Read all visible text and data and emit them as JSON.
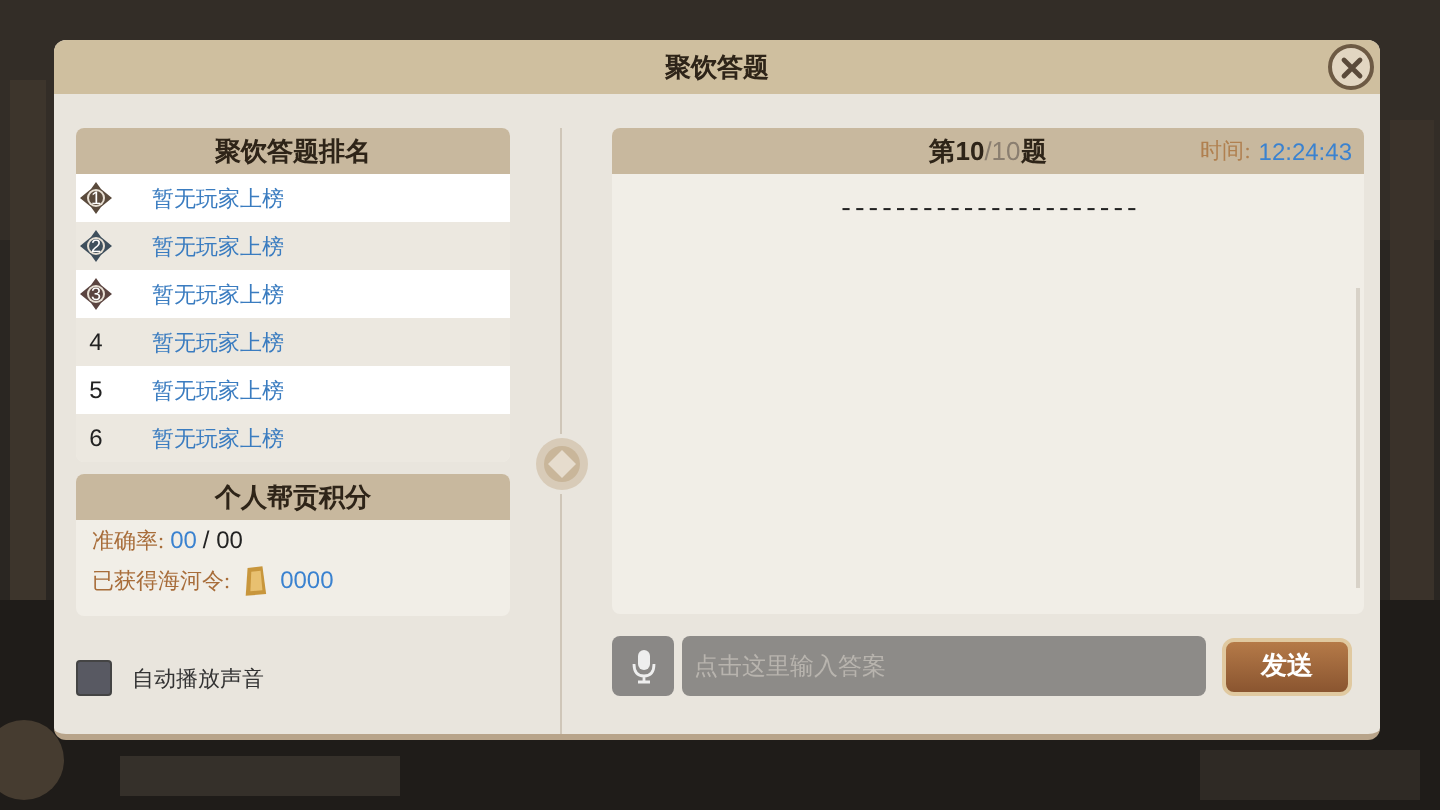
{
  "window": {
    "title": "聚饮答题"
  },
  "ranking": {
    "title": "聚饮答题排名",
    "rows": [
      {
        "rank": "1",
        "name": "暂无玩家上榜",
        "kind": "medal",
        "color": "#5a4a3c"
      },
      {
        "rank": "2",
        "name": "暂无玩家上榜",
        "kind": "medal",
        "color": "#3f4f5c"
      },
      {
        "rank": "3",
        "name": "暂无玩家上榜",
        "kind": "medal",
        "color": "#5b4440"
      },
      {
        "rank": "4",
        "name": "暂无玩家上榜",
        "kind": "plain"
      },
      {
        "rank": "5",
        "name": "暂无玩家上榜",
        "kind": "plain"
      },
      {
        "rank": "6",
        "name": "暂无玩家上榜",
        "kind": "plain"
      }
    ]
  },
  "score": {
    "title": "个人帮贡积分",
    "accuracy_label": "准确率:",
    "accuracy_correct": "00",
    "accuracy_total": "/ 00",
    "token_label": "已获得海河令:",
    "token_value": "0000"
  },
  "auto_play": {
    "label": "自动播放声音",
    "checked": false
  },
  "question": {
    "prefix": "第",
    "current": "10",
    "total": "/10",
    "suffix": "题",
    "time_label": "时间:",
    "time_value": "12:24:43",
    "text": "----------------------"
  },
  "answer": {
    "placeholder": "点击这里输入答案"
  },
  "send_button": "发送"
}
